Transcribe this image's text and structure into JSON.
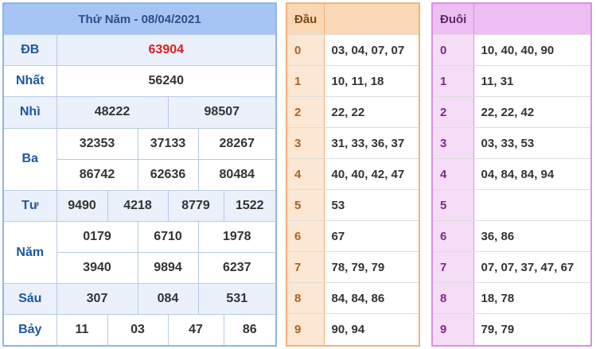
{
  "results": {
    "title": "Thứ Năm - 08/04/2021",
    "prizes": {
      "db": {
        "label": "ĐB",
        "values": [
          "63904"
        ]
      },
      "nhat": {
        "label": "Nhất",
        "values": [
          "56240"
        ]
      },
      "nhi": {
        "label": "Nhì",
        "values": [
          "48222",
          "98507"
        ]
      },
      "ba": {
        "label": "Ba",
        "values": [
          "32353",
          "37133",
          "28267",
          "86742",
          "62636",
          "80484"
        ]
      },
      "tu": {
        "label": "Tư",
        "values": [
          "9490",
          "4218",
          "8779",
          "1522"
        ]
      },
      "nam": {
        "label": "Năm",
        "values": [
          "0179",
          "6710",
          "1978",
          "3940",
          "9894",
          "6237"
        ]
      },
      "sau": {
        "label": "Sáu",
        "values": [
          "307",
          "084",
          "531"
        ]
      },
      "bay": {
        "label": "Bảy",
        "values": [
          "11",
          "03",
          "47",
          "86"
        ]
      }
    }
  },
  "dau": {
    "header": "Đầu",
    "rows": [
      {
        "digit": "0",
        "values": "03, 04, 07, 07"
      },
      {
        "digit": "1",
        "values": "10, 11, 18"
      },
      {
        "digit": "2",
        "values": "22, 22"
      },
      {
        "digit": "3",
        "values": "31, 33, 36, 37"
      },
      {
        "digit": "4",
        "values": "40, 40, 42, 47"
      },
      {
        "digit": "5",
        "values": "53"
      },
      {
        "digit": "6",
        "values": "67"
      },
      {
        "digit": "7",
        "values": "78, 79, 79"
      },
      {
        "digit": "8",
        "values": "84, 84, 86"
      },
      {
        "digit": "9",
        "values": "90, 94"
      }
    ]
  },
  "duoi": {
    "header": "Đuôi",
    "rows": [
      {
        "digit": "0",
        "values": "10, 40, 40, 90"
      },
      {
        "digit": "1",
        "values": "11, 31"
      },
      {
        "digit": "2",
        "values": "22, 22, 42"
      },
      {
        "digit": "3",
        "values": "03, 33, 53"
      },
      {
        "digit": "4",
        "values": "04, 84, 84, 94"
      },
      {
        "digit": "5",
        "values": ""
      },
      {
        "digit": "6",
        "values": "36, 86"
      },
      {
        "digit": "7",
        "values": "07, 07, 37, 47, 67"
      },
      {
        "digit": "8",
        "values": "18, 78"
      },
      {
        "digit": "9",
        "values": "79, 79"
      }
    ]
  },
  "colors": {
    "results_header": "#a6c5f4",
    "special_prize": "#e01b1b",
    "dau_header": "#fad8b6",
    "duoi_header": "#eebdf3"
  }
}
